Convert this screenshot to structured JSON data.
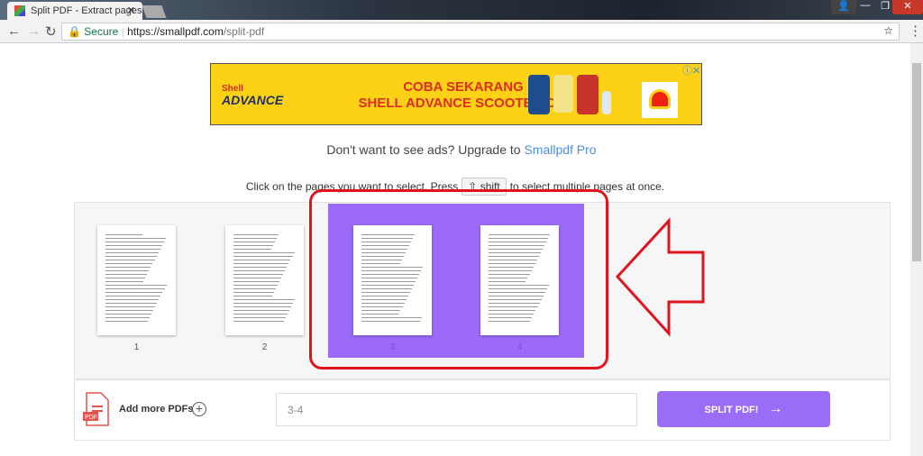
{
  "browser": {
    "tab_title": "Split PDF - Extract pages",
    "secure_label": "Secure",
    "url_scheme": "https://",
    "url_host": "smallpdf.com",
    "url_path": "/split-pdf"
  },
  "ad": {
    "brand": "Shell",
    "product": "ADVANCE",
    "line1": "COBA SEKARANG",
    "line2": "SHELL ADVANCE SCOOTER OIL"
  },
  "upsell": {
    "text": "Don't want to see ads? Upgrade to ",
    "link": "Smallpdf Pro"
  },
  "instructions": {
    "before": "Click on the pages you want to select. Press",
    "key": "shift",
    "after": "to select multiple pages at once."
  },
  "pages": [
    {
      "label": "1",
      "selected": false
    },
    {
      "label": "2",
      "selected": false
    },
    {
      "label": "3",
      "selected": true
    },
    {
      "label": "4",
      "selected": true
    }
  ],
  "bottom": {
    "add_more": "Add more PDFs",
    "range_value": "3-4",
    "split_label": "SPLIT PDF!",
    "pdf_badge": "PDF"
  },
  "colors": {
    "accent": "#9b6cf6",
    "highlight": "#e0141e"
  }
}
